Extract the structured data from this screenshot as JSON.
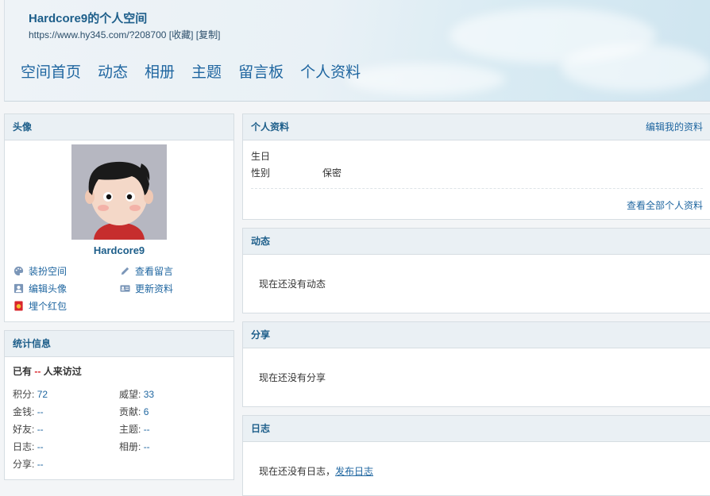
{
  "header": {
    "title": "Hardcore9的个人空间",
    "url": "https://www.hy345.com/?208700",
    "favorite": "[收藏]",
    "copy": "[复制]",
    "nav": [
      "空间首页",
      "动态",
      "相册",
      "主题",
      "留言板",
      "个人资料"
    ]
  },
  "avatar_panel": {
    "title": "头像",
    "username": "Hardcore9",
    "actions": [
      {
        "label": "装扮空间",
        "icon": "palette-icon"
      },
      {
        "label": "查看留言",
        "icon": "pencil-icon"
      },
      {
        "label": "编辑头像",
        "icon": "portrait-icon"
      },
      {
        "label": "更新资料",
        "icon": "id-card-icon"
      },
      {
        "label": "埋个红包",
        "icon": "red-envelope-icon"
      }
    ]
  },
  "stats_panel": {
    "title": "统计信息",
    "visits_prefix": "已有",
    "visits_value": "--",
    "visits_suffix": "人来访过",
    "items": [
      {
        "label": "积分:",
        "value": "72"
      },
      {
        "label": "威望:",
        "value": "33"
      },
      {
        "label": "金钱:",
        "value": "--"
      },
      {
        "label": "贡献:",
        "value": "6"
      },
      {
        "label": "好友:",
        "value": "--"
      },
      {
        "label": "主题:",
        "value": "--"
      },
      {
        "label": "日志:",
        "value": "--"
      },
      {
        "label": "相册:",
        "value": "--"
      },
      {
        "label": "分享:",
        "value": "--"
      }
    ]
  },
  "profile_panel": {
    "title": "个人资料",
    "edit_link": "编辑我的资料",
    "birthday_label": "生日",
    "gender_label": "性别",
    "gender_value": "保密",
    "view_all": "查看全部个人资料"
  },
  "feed_panel": {
    "title": "动态",
    "empty": "现在还没有动态"
  },
  "share_panel": {
    "title": "分享",
    "empty": "现在还没有分享"
  },
  "blog_panel": {
    "title": "日志",
    "empty": "现在还没有日志，",
    "post_link": "发布日志"
  },
  "colors": {
    "link": "#1f66a0",
    "title": "#1d5e8a",
    "accent_red": "#d9262c"
  }
}
